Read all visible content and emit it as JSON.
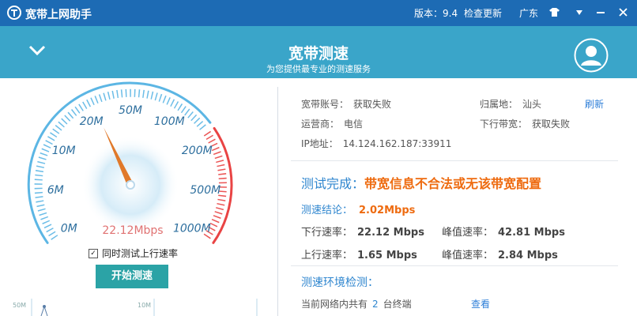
{
  "titlebar": {
    "app_title": "宽带上网助手",
    "version": "版本：9.4",
    "check_update": "检查更新",
    "region": "广东",
    "icons": [
      "shirt-icon",
      "dropdown-icon",
      "minimize-icon",
      "close-icon"
    ]
  },
  "header": {
    "title": "宽带测速",
    "subtitle": "为您提供最专业的测速服务"
  },
  "gauge": {
    "ticks": [
      "0M",
      "6M",
      "10M",
      "20M",
      "50M",
      "100M",
      "200M",
      "500M",
      "1000M"
    ],
    "reading": "22.12Mbps",
    "colors": {
      "normal": "#5cb6e4",
      "high": "#e94444",
      "needle": "#e0792a"
    }
  },
  "sync_test_label": "同时测试上行速率",
  "sync_test_checked": true,
  "start_button": "开始测速",
  "mini_chart": {
    "labels": [
      "50M",
      "10M"
    ]
  },
  "account": {
    "broadband_label": "宽带账号：",
    "broadband_value": "获取失败",
    "home_label": "归属地：",
    "home_value": "汕头",
    "refresh": "刷新",
    "isp_label": "运营商：",
    "isp_value": "电信",
    "bandwidth_label": "下行带宽：",
    "bandwidth_value": "获取失败",
    "ip_label": "IP地址：",
    "ip_value": "14.124.162.187:33911"
  },
  "result": {
    "title_prefix": "测试完成：",
    "title_message": "带宽信息不合法或无该带宽配置",
    "conclusion_label": "测速结论：",
    "conclusion_value": "2.02Mbps",
    "down_label": "下行速率：",
    "down_value": "22.12 Mbps",
    "down_peak_label": "峰值速率：",
    "down_peak_value": "42.81 Mbps",
    "up_label": "上行速率：",
    "up_value": "1.65 Mbps",
    "up_peak_label": "峰值速率：",
    "up_peak_value": "2.84 Mbps"
  },
  "environment": {
    "title": "测速环境检测：",
    "devices_prefix": "当前网络内共有",
    "devices_count": "2",
    "devices_suffix": "台终端",
    "view_link": "查看"
  }
}
